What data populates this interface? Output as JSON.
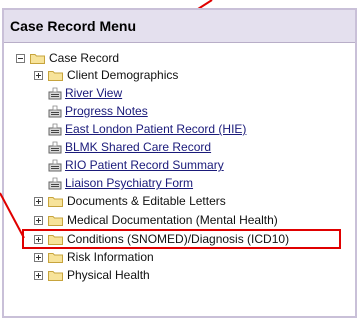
{
  "menu": {
    "title": "Case Record Menu"
  },
  "tree": {
    "root": "Case Record",
    "client_demographics": "Client Demographics",
    "river_view": "River View",
    "progress_notes": "Progress Notes",
    "east_london": "East London Patient Record (HIE)",
    "blmk": "BLMK Shared Care Record",
    "rio_summary": "RIO Patient Record Summary",
    "liaison": "Liaison Psychiatry Form",
    "documents": "Documents & Editable Letters",
    "medical_doc": "Medical Documentation (Mental Health)",
    "conditions": "Conditions (SNOMED)/Diagnosis (ICD10)",
    "risk": "Risk Information",
    "physical": "Physical Health"
  },
  "colors": {
    "highlight": "#e00000",
    "header_bg": "#e4e0ee",
    "link": "#1a1a7a"
  },
  "icons": {
    "folder": "folder-icon",
    "document": "document-link-icon",
    "expander_minus": "collapse-icon",
    "expander_plus": "expand-icon"
  }
}
